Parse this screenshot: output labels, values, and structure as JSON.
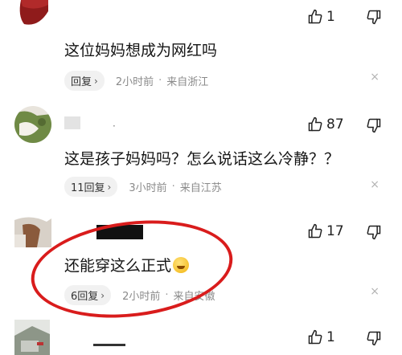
{
  "comments": [
    {
      "text": "这位妈妈想成为网红吗",
      "reply_label": "回复",
      "time": "2小时前",
      "location": "来自浙江",
      "likes": "1"
    },
    {
      "text": "这是孩子妈妈吗？怎么说话这么冷静？？",
      "reply_label": "11回复",
      "time": "3小时前",
      "location": "来自江苏",
      "likes": "87"
    },
    {
      "text": "还能穿这么正式",
      "reply_label": "6回复",
      "time": "2小时前",
      "location": "来自安徽",
      "likes": "17"
    },
    {
      "likes": "1"
    }
  ],
  "separator": "·",
  "chevron": "›",
  "close_symbol": "×",
  "icons": {
    "like": "thumbs-up-icon",
    "dislike": "thumbs-down-icon",
    "close": "close-icon",
    "emoji": "laughing-crying-emoji"
  },
  "colors": {
    "annotation_circle": "#d91c1c",
    "meta_text": "#8a8a8a",
    "reply_pill_bg": "#f1f1f1"
  }
}
